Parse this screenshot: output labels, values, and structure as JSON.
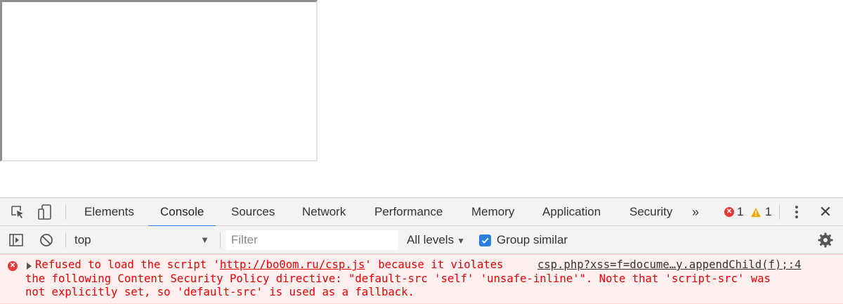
{
  "devtools": {
    "tabs": [
      {
        "label": "Elements"
      },
      {
        "label": "Console"
      },
      {
        "label": "Sources"
      },
      {
        "label": "Network"
      },
      {
        "label": "Performance"
      },
      {
        "label": "Memory"
      },
      {
        "label": "Application"
      },
      {
        "label": "Security"
      }
    ],
    "active_tab": "Console",
    "more_tabs_label": "»",
    "error_count": "1",
    "warning_count": "1",
    "icons": [
      "inspect-element-icon",
      "device-toolbar-icon",
      "sidebar-toggle-icon",
      "clear-console-icon",
      "error-icon",
      "warning-icon",
      "kebab-menu-icon",
      "close-icon",
      "settings-gear-icon",
      "expand-triangle-icon",
      "checkbox-checked-icon"
    ]
  },
  "console_toolbar": {
    "context": "top",
    "filter_placeholder": "Filter",
    "levels_label": "All levels",
    "group_similar_label": "Group similar",
    "group_similar_checked": true
  },
  "console_messages": [
    {
      "level": "error",
      "prefix": "Refused to load the script '",
      "url": "http://bo0om.ru/csp.js",
      "line1_suffix": "' because it violates",
      "line2": "the following Content Security Policy directive: \"default-src 'self' 'unsafe-inline'\". Note that 'script-src' was",
      "line3": "not explicitly set, so 'default-src' is used as a fallback.",
      "source": "csp.php?xss=f=docume…y.appendChild(f);:4"
    }
  ],
  "colors": {
    "accent": "#2a7de1",
    "error_text": "#e60000",
    "error_bg": "#fff0f0",
    "toolbar_bg": "#f3f3f3",
    "warning": "#f2a600"
  }
}
